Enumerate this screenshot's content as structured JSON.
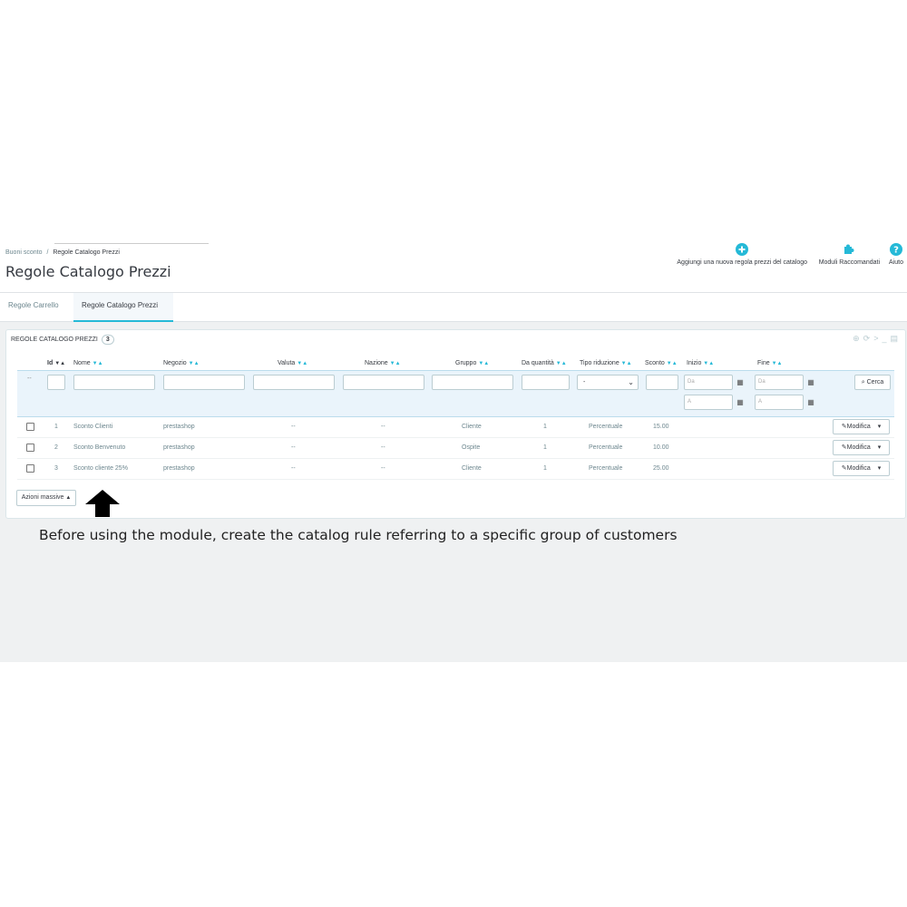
{
  "breadcrumb": {
    "parent": "Buoni sconto",
    "sep": "/",
    "current": "Regole Catalogo Prezzi"
  },
  "page_title": "Regole Catalogo Prezzi",
  "toolbar": {
    "add_label": "Aggiungi una nuova regola prezzi del catalogo",
    "modules_label": "Moduli Raccomandati",
    "help_label": "Aiuto"
  },
  "tabs": [
    {
      "label": "Regole Carrello",
      "active": false
    },
    {
      "label": "Regole Catalogo Prezzi",
      "active": true
    }
  ],
  "panel": {
    "title": "REGOLE CATALOGO PREZZI",
    "count": "3",
    "icons": [
      "add-icon",
      "refresh-icon",
      "terminal-icon",
      "database-icon"
    ]
  },
  "columns": [
    "Id",
    "Nome",
    "Negozio",
    "Valuta",
    "Nazione",
    "Gruppo",
    "Da quantità",
    "Tipo riduzione",
    "Sconto",
    "Inizio",
    "Fine"
  ],
  "filters": {
    "id_placeholder": "--",
    "tipo_riduzione_value": "-",
    "inizio_da": "Da",
    "inizio_a": "A",
    "fine_da": "Da",
    "fine_a": "A",
    "search_label": "Cerca"
  },
  "rows": [
    {
      "id": "1",
      "nome": "Sconto Clienti",
      "negozio": "prestashop",
      "valuta": "--",
      "nazione": "--",
      "gruppo": "Cliente",
      "da_quantita": "1",
      "tipo_riduzione": "Percentuale",
      "sconto": "15.00",
      "inizio": "",
      "fine": "",
      "action": "Modifica"
    },
    {
      "id": "2",
      "nome": "Sconto Benvenuto",
      "negozio": "prestashop",
      "valuta": "--",
      "nazione": "--",
      "gruppo": "Ospite",
      "da_quantita": "1",
      "tipo_riduzione": "Percentuale",
      "sconto": "10.00",
      "inizio": "",
      "fine": "",
      "action": "Modifica"
    },
    {
      "id": "3",
      "nome": "Sconto cliente 25%",
      "negozio": "prestashop",
      "valuta": "--",
      "nazione": "--",
      "gruppo": "Cliente",
      "da_quantita": "1",
      "tipo_riduzione": "Percentuale",
      "sconto": "25.00",
      "inizio": "",
      "fine": "",
      "action": "Modifica"
    }
  ],
  "bulk_actions_label": "Azioni massive",
  "caption": "Before using the module, create the catalog rule referring to a specific group of customers",
  "colors": {
    "accent": "#25b9d7",
    "background": "#eff1f2",
    "text": "#363a41",
    "muted": "#6c868e"
  }
}
